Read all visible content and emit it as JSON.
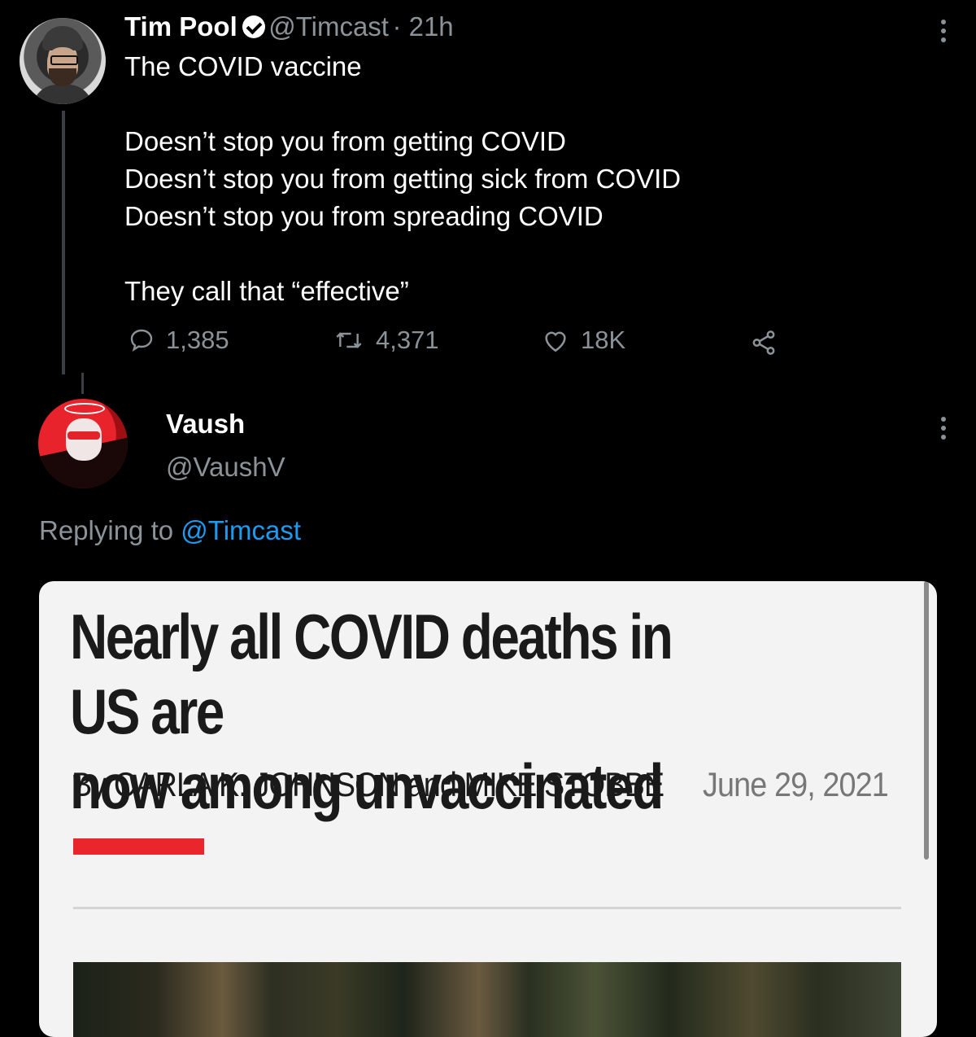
{
  "tweet1": {
    "name": "Tim Pool",
    "handle": "@Timcast",
    "time": "· 21h",
    "lines": [
      "The COVID vaccine",
      "",
      "Doesn’t stop you from getting COVID",
      "Doesn’t stop you from getting sick from COVID",
      "Doesn’t stop you from spreading COVID",
      "",
      "They call that “effective”"
    ],
    "replies": "1,385",
    "retweets": "4,371",
    "likes": "18K"
  },
  "tweet2": {
    "name": "Vaush",
    "handle": "@VaushV",
    "replying_prefix": "Replying to",
    "replying_to": "@Timcast"
  },
  "article": {
    "headline_line1": "Nearly all COVID deaths in US are",
    "headline_line2": "now among unvaccinated",
    "byline": "By CARLA K. JOHNSON and MIKE STOBBE",
    "date": "June 29, 2021",
    "accent_color": "#e8262b"
  },
  "colors": {
    "background": "#000000",
    "muted": "#8b9298",
    "link": "#1d9bf0"
  },
  "icons": {
    "verified": "verified-badge-icon",
    "more": "more-vertical-icon",
    "reply": "reply-icon",
    "retweet": "retweet-icon",
    "like": "heart-icon",
    "share": "share-icon"
  }
}
